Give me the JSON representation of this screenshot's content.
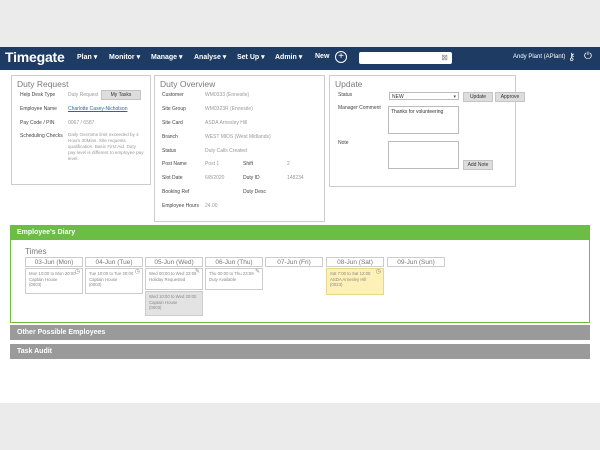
{
  "app": {
    "logo": "Timegate"
  },
  "nav": [
    "Plan ▾",
    "Monitor ▾",
    "Manage ▾",
    "Analyse ▾",
    "Set Up ▾",
    "Admin ▾",
    "New"
  ],
  "user": "Andy Plant (APlant)",
  "duty_request": {
    "title": "Duty Request",
    "help_desk_type_label": "Help Desk Type",
    "help_desk_type_value": "Duty Request",
    "my_tasks_button": "My Tasks",
    "employee_name_label": "Employee Name",
    "employee_name_value": "Charlotte Casey-Nicholson",
    "pay_code_label": "Pay Code / PIN",
    "pay_code_value": "0067 / 6587",
    "scheduling_checks_label": "Scheduling Checks",
    "scheduling_checks_value": "Daily Overtime limit exceeded by 4 Hours 30Mins. Site requests qualification. Basic First Aid. Duty pay level is different to employee pay level."
  },
  "duty_overview": {
    "title": "Duty Overview",
    "customer_label": "Customer",
    "customer_value": "WM0333 (Ennesite)",
    "site_group_label": "Site Group",
    "site_group_value": "WM0323R (Ennesite)",
    "site_card_label": "Site Card",
    "site_card_value": "ASDA Arnesley Hill",
    "branch_label": "Branch",
    "branch_value": "WEST MIDS (West Midlands)",
    "status_label": "Status",
    "status_value": "Duty Calls Created",
    "post_name_label": "Post Name",
    "post_name_value": "Post 1",
    "shift_label": "Shift",
    "shift_value": "2",
    "slot_date_label": "Slot Date",
    "slot_date_value": "6/8/2020",
    "duty_id_label": "Duty ID",
    "duty_id_value": "148234",
    "booking_ref_label": "Booking Ref",
    "duty_desc_label": "Duty Desc",
    "employee_hours_label": "Employee Hours",
    "employee_hours_value": "24.00"
  },
  "update": {
    "title": "Update",
    "status_label": "Status",
    "status_value": "NEW",
    "update_button": "Update",
    "approve_button": "Approve",
    "manager_comment_label": "Manager Comment",
    "manager_comment_value": "Thanks for volunteering",
    "note_label": "Note",
    "note_value": "",
    "add_note_button": "Add Note"
  },
  "sections": {
    "diary": "Employee's Diary",
    "other": "Other Possible Employees",
    "audit": "Task Audit"
  },
  "times_label": "Times",
  "days": [
    "03-Jun (Mon)",
    "04-Jun (Tue)",
    "05-Jun (Wed)",
    "06-Jun (Thu)",
    "07-Jun (Fri)",
    "08-Jun (Sat)",
    "09-Jun (Sun)"
  ],
  "cards": [
    {
      "time": "Mon 10:00 to Mon 20:00",
      "site": "Captain House",
      "code": "(0003)"
    },
    {
      "time": "Tue 10:00 to Tue 20:00",
      "site": "Captain House",
      "code": "(0003)"
    },
    {
      "time": "Wed 00:00 to Wed 23:59",
      "site": "Holiday Requested",
      "code": ""
    },
    {
      "time": "Wed 10:00 to Wed 20:00",
      "site": "Captain House",
      "code": "(0003)"
    },
    {
      "time": "Thu 00:00 to Thu 23:59",
      "site": "Duty Available",
      "code": ""
    },
    {
      "time": "Sat 7:00 to Sat 12:00",
      "site": "ASDA Arnesley Hill",
      "code": "(0023)"
    }
  ],
  "colors": {
    "nav_bg": "#1d3b63",
    "diary_green": "#6cbd45",
    "section_gray": "#9a9a9a",
    "highlight_yellow": "#fdf1b8"
  }
}
